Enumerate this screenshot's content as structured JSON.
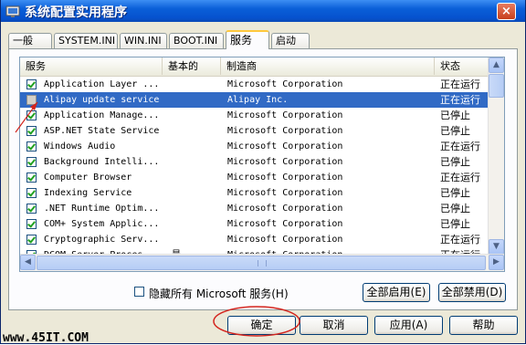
{
  "window": {
    "title": "系统配置实用程序",
    "close": "×"
  },
  "tabs": [
    "一般",
    "SYSTEM.INI",
    "WIN.INI",
    "BOOT.INI",
    "服务",
    "启动"
  ],
  "active_tab": "服务",
  "columns": [
    "服务",
    "基本的",
    "制造商",
    "状态"
  ],
  "services": [
    {
      "name": "Application Layer ...",
      "essential": "",
      "maker": "Microsoft Corporation",
      "status": "正在运行",
      "checked": true
    },
    {
      "name": "Alipay update service",
      "essential": "",
      "maker": "Alipay Inc.",
      "status": "正在运行",
      "checked": false,
      "selected": true
    },
    {
      "name": "Application Manage...",
      "essential": "",
      "maker": "Microsoft Corporation",
      "status": "已停止",
      "checked": true
    },
    {
      "name": "ASP.NET State Service",
      "essential": "",
      "maker": "Microsoft Corporation",
      "status": "已停止",
      "checked": true
    },
    {
      "name": "Windows Audio",
      "essential": "",
      "maker": "Microsoft Corporation",
      "status": "正在运行",
      "checked": true
    },
    {
      "name": "Background Intelli...",
      "essential": "",
      "maker": "Microsoft Corporation",
      "status": "已停止",
      "checked": true
    },
    {
      "name": "Computer Browser",
      "essential": "",
      "maker": "Microsoft Corporation",
      "status": "正在运行",
      "checked": true
    },
    {
      "name": "Indexing Service",
      "essential": "",
      "maker": "Microsoft Corporation",
      "status": "已停止",
      "checked": true
    },
    {
      "name": ".NET Runtime Optim...",
      "essential": "",
      "maker": "Microsoft Corporation",
      "status": "已停止",
      "checked": true
    },
    {
      "name": "COM+ System Applic...",
      "essential": "",
      "maker": "Microsoft Corporation",
      "status": "已停止",
      "checked": true
    },
    {
      "name": "Cryptographic Serv...",
      "essential": "",
      "maker": "Microsoft Corporation",
      "status": "正在运行",
      "checked": true
    },
    {
      "name": "DCOM Server Proces...",
      "essential": "是",
      "maker": "Microsoft Corporation",
      "status": "正在运行",
      "checked": true
    }
  ],
  "hide_ms_label": "隐藏所有 Microsoft 服务(H)",
  "buttons": {
    "enable_all": "全部启用(E)",
    "disable_all": "全部禁用(D)",
    "ok": "确定",
    "cancel": "取消",
    "apply": "应用(A)",
    "help": "帮助"
  },
  "watermark": "www.45IT.COM",
  "colors": {
    "selection": "#316ac5",
    "titlebar": "#0a5fd8",
    "highlight_annotation": "#d4251e"
  }
}
